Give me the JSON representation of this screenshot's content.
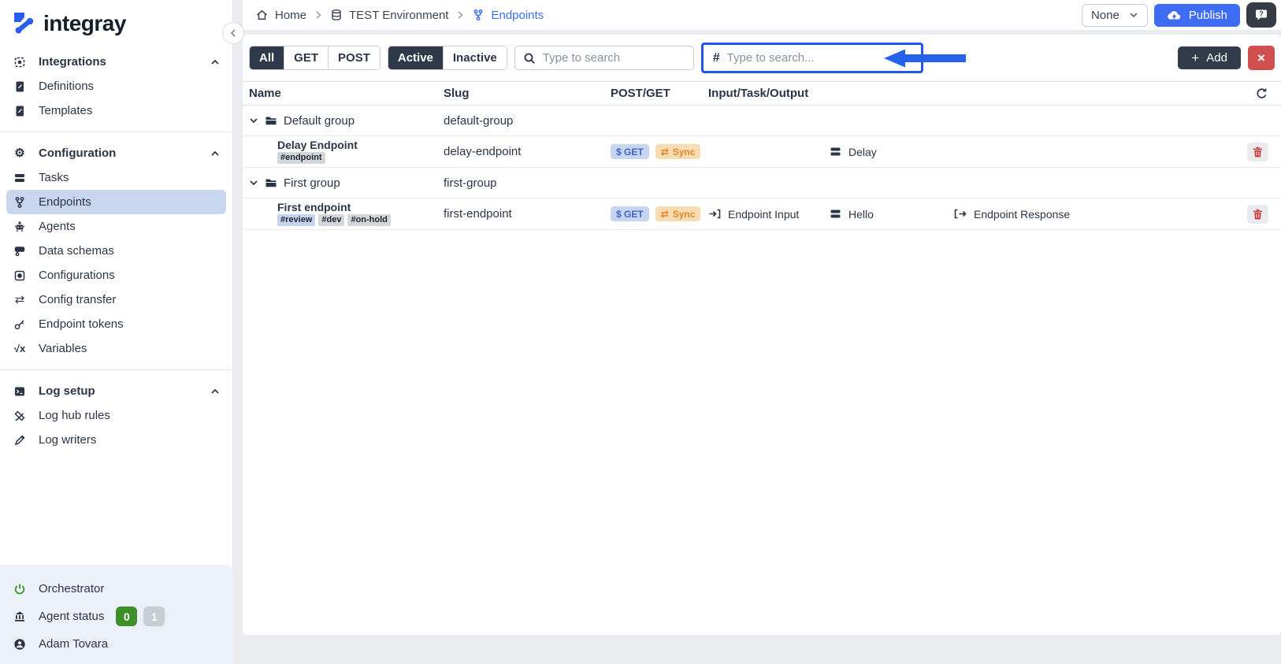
{
  "brand": {
    "name": "integray"
  },
  "topbar": {
    "breadcrumb": [
      {
        "label": "Home"
      },
      {
        "label": "TEST Environment"
      },
      {
        "label": "Endpoints"
      }
    ],
    "version_select": {
      "value": "None"
    },
    "publish_label": "Publish"
  },
  "filters": {
    "methods": {
      "all": "All",
      "get": "GET",
      "post": "POST"
    },
    "states": {
      "active": "Active",
      "inactive": "Inactive"
    },
    "search_placeholder": "Type to search",
    "tag_search_placeholder": "Type to search...",
    "add_label": "Add"
  },
  "table": {
    "headers": {
      "name": "Name",
      "slug": "Slug",
      "post_get": "POST/GET",
      "io": "Input/Task/Output"
    },
    "rows": [
      {
        "type": "group",
        "name": "Default group",
        "slug": "default-group"
      },
      {
        "type": "endpoint",
        "name": "Delay Endpoint",
        "tags": [
          "#endpoint"
        ],
        "slug": "delay-endpoint",
        "method_badge": "$ GET",
        "mode_badge": "Sync",
        "task": "Delay"
      },
      {
        "type": "group",
        "name": "First group",
        "slug": "first-group"
      },
      {
        "type": "endpoint",
        "name": "First endpoint",
        "tags": [
          "#review",
          "#dev",
          "#on-hold"
        ],
        "slug": "first-endpoint",
        "method_badge": "$ GET",
        "mode_badge": "Sync",
        "input": "Endpoint Input",
        "task": "Hello",
        "output": "Endpoint Response"
      }
    ]
  },
  "sidebar": {
    "sections": [
      {
        "label": "Integrations",
        "items": [
          {
            "label": "Definitions"
          },
          {
            "label": "Templates"
          }
        ]
      },
      {
        "label": "Configuration",
        "items": [
          {
            "label": "Tasks"
          },
          {
            "label": "Endpoints"
          },
          {
            "label": "Agents"
          },
          {
            "label": "Data schemas"
          },
          {
            "label": "Configurations"
          },
          {
            "label": "Config transfer"
          },
          {
            "label": "Endpoint tokens"
          },
          {
            "label": "Variables"
          }
        ]
      },
      {
        "label": "Log setup",
        "items": [
          {
            "label": "Log hub rules"
          },
          {
            "label": "Log writers"
          }
        ]
      }
    ],
    "footer": {
      "orchestrator": "Orchestrator",
      "agent_status": "Agent status",
      "agents_online": "0",
      "agents_offline": "1",
      "user": "Adam Tovara"
    }
  },
  "colors": {
    "accent": "#2356e8",
    "publish_button": "#3e6cf3",
    "danger": "#d04f4f",
    "get_badge_bg": "#c7d5f1",
    "get_badge_text": "#3f63c6",
    "sync_badge_bg": "#f7dcb4",
    "sync_badge_text": "#df892a",
    "selected_nav_bg": "#c8d6ee",
    "agents_online_bg": "#3f8f29"
  }
}
